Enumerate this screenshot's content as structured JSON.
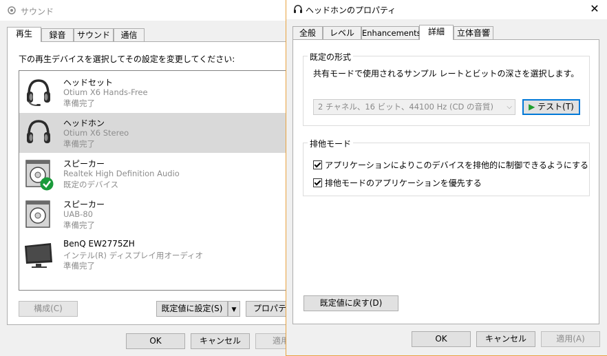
{
  "sound_window": {
    "title": "サウンド",
    "tabs": [
      {
        "label": "再生",
        "active": true
      },
      {
        "label": "録音",
        "active": false
      },
      {
        "label": "サウンド",
        "active": false
      },
      {
        "label": "通信",
        "active": false
      }
    ],
    "instruction": "下の再生デバイスを選択してその設定を変更してください:",
    "devices": [
      {
        "name": "ヘッドセット",
        "model": "Otium X6 Hands-Free",
        "status": "準備完了",
        "icon": "headset-icon",
        "selected": false
      },
      {
        "name": "ヘッドホン",
        "model": "Otium X6 Stereo",
        "status": "準備完了",
        "icon": "headphones-icon",
        "selected": true
      },
      {
        "name": "スピーカー",
        "model": "Realtek High Definition Audio",
        "status": "既定のデバイス",
        "icon": "speaker-icon",
        "selected": false
      },
      {
        "name": "スピーカー",
        "model": "UAB-80",
        "status": "準備完了",
        "icon": "speaker-icon",
        "selected": false
      },
      {
        "name": "BenQ EW2775ZH",
        "model": "インテル(R) ディスプレイ用オーディオ",
        "status": "準備完了",
        "icon": "monitor-icon",
        "selected": false
      }
    ],
    "buttons": {
      "configure": "構成(C)",
      "set_default": "既定値に設定(S)",
      "properties": "プロパティ(P)",
      "ok": "OK",
      "cancel": "キャンセル",
      "apply": "適用(A)"
    }
  },
  "prop_window": {
    "title": "ヘッドホンのプロパティ",
    "tabs": [
      {
        "label": "全般",
        "active": false
      },
      {
        "label": "レベル",
        "active": false
      },
      {
        "label": "Enhancements",
        "active": false
      },
      {
        "label": "詳細",
        "active": true
      },
      {
        "label": "立体音響",
        "active": false
      }
    ],
    "default_format": {
      "label": "既定の形式",
      "description": "共有モードで使用されるサンプル レートとビットの深さを選択します。",
      "selected": "2 チャネル、16 ビット、44100 Hz (CD の音質)",
      "test_button": "テスト(T)"
    },
    "exclusive_mode": {
      "label": "排他モード",
      "options": [
        {
          "label": "アプリケーションによりこのデバイスを排他的に制御できるようにする",
          "checked": true
        },
        {
          "label": "排他モードのアプリケーションを優先する",
          "checked": true
        }
      ]
    },
    "buttons": {
      "restore_defaults": "既定値に戻す(D)",
      "ok": "OK",
      "cancel": "キャンセル",
      "apply": "適用(A)"
    }
  },
  "colors": {
    "selected_row": "#d9d9d9",
    "accent": "#0078d7",
    "check_badge": "#1a9a3a",
    "play_arrow": "#1f9e2e"
  }
}
